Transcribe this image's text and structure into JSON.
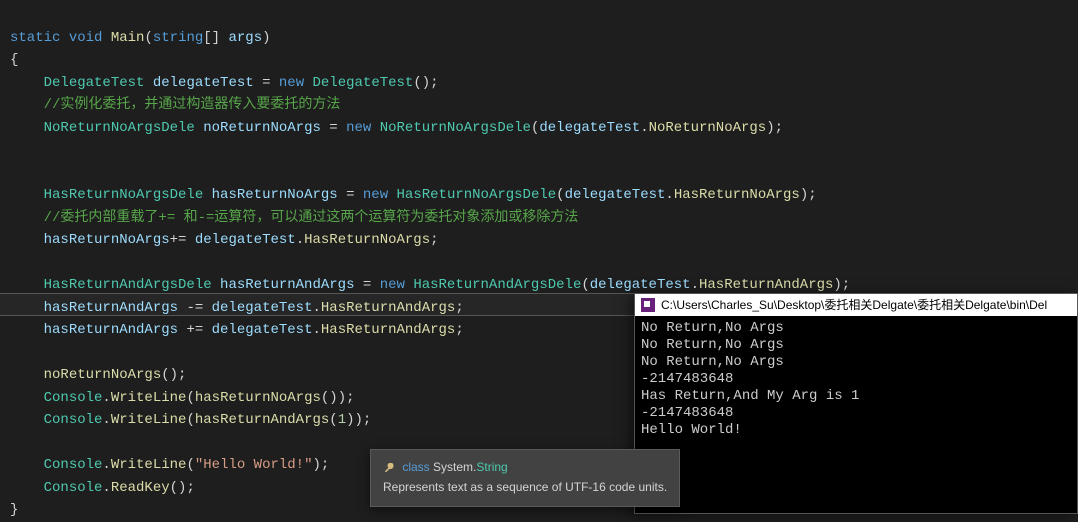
{
  "code": {
    "sig_static": "static",
    "sig_void": "void",
    "sig_main": "Main",
    "sig_string": "string",
    "sig_args": "args",
    "open_brace": "{",
    "close_brace": "}",
    "indent": "    ",
    "t_DelegateTest": "DelegateTest",
    "v_delegateTest": "delegateTest",
    "kw_new": "new",
    "comment1": "//实例化委托，并通过构造器传入要委托的方法",
    "t_NoReturnNoArgsDele": "NoReturnNoArgsDele",
    "v_noReturnNoArgs": "noReturnNoArgs",
    "m_NoReturnNoArgs": "NoReturnNoArgs",
    "t_HasReturnNoArgsDele": "HasReturnNoArgsDele",
    "v_hasReturnNoArgs": "hasReturnNoArgs",
    "m_HasReturnNoArgs": "HasReturnNoArgs",
    "comment2": "//委托内部重载了+= 和-=运算符，可以通过这两个运算符为委托对象添加或移除方法",
    "t_HasReturnAndArgsDele": "HasReturnAndArgsDele",
    "v_hasReturnAndArgs": "hasReturnAndArgs",
    "m_HasReturnAndArgs": "HasReturnAndArgs",
    "t_Console": "Console",
    "m_WriteLine": "WriteLine",
    "m_ReadKey": "ReadKey",
    "num_1": "1",
    "str_hello": "\"Hello World!\""
  },
  "console": {
    "title": "C:\\Users\\Charles_Su\\Desktop\\委托相关Delgate\\委托相关Delgate\\bin\\Del",
    "lines": [
      "No Return,No Args",
      "No Return,No Args",
      "No Return,No Args",
      "-2147483648",
      "Has Return,And My Arg is 1",
      "-2147483648",
      "Hello World!"
    ]
  },
  "tooltip": {
    "kw": "class",
    "ns": "System.",
    "type": "String",
    "desc": "Represents text as a sequence of UTF-16 code units."
  }
}
